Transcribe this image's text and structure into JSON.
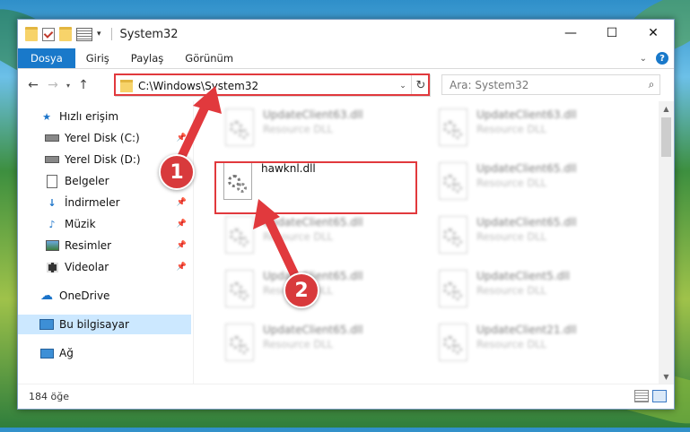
{
  "window": {
    "title": "System32"
  },
  "ribbon": {
    "tabs": [
      {
        "label": "Dosya"
      },
      {
        "label": "Giriş"
      },
      {
        "label": "Paylaş"
      },
      {
        "label": "Görünüm"
      }
    ]
  },
  "address": {
    "path": "C:\\Windows\\System32"
  },
  "search": {
    "placeholder": "Ara: System32"
  },
  "sidebar": {
    "items": [
      {
        "label": "Hızlı erişim",
        "icon": "star-icon"
      },
      {
        "label": "Yerel Disk (C:)",
        "icon": "drive-icon",
        "pinned": true
      },
      {
        "label": "Yerel Disk (D:)",
        "icon": "drive-icon",
        "pinned": false
      },
      {
        "label": "Belgeler",
        "icon": "document-icon",
        "pinned": true
      },
      {
        "label": "İndirmeler",
        "icon": "download-icon",
        "pinned": true
      },
      {
        "label": "Müzik",
        "icon": "music-icon",
        "pinned": true
      },
      {
        "label": "Resimler",
        "icon": "picture-icon",
        "pinned": true
      },
      {
        "label": "Videolar",
        "icon": "video-icon",
        "pinned": true
      },
      {
        "label": "OneDrive",
        "icon": "cloud-icon"
      },
      {
        "label": "Bu bilgisayar",
        "icon": "computer-icon",
        "selected": true
      },
      {
        "label": "Ağ",
        "icon": "network-icon"
      }
    ]
  },
  "files": [
    {
      "name": "UpdateClient63.dll",
      "desc": "Resource DLL",
      "blurred": true
    },
    {
      "name": "UpdateClient63.dll",
      "desc": "Resource DLL",
      "blurred": true
    },
    {
      "name": "hawknl.dll",
      "desc": "",
      "blurred": false
    },
    {
      "name": "UpdateClient65.dll",
      "desc": "Resource DLL",
      "blurred": true
    },
    {
      "name": "UpdateClient65.dll",
      "desc": "Resource DLL",
      "blurred": true
    },
    {
      "name": "UpdateClient65.dll",
      "desc": "Resource DLL",
      "blurred": true
    },
    {
      "name": "UpdateClient65.dll",
      "desc": "Resource DLL",
      "blurred": true
    },
    {
      "name": "UpdateClient5.dll",
      "desc": "Resource DLL",
      "blurred": true
    },
    {
      "name": "UpdateClient65.dll",
      "desc": "Resource DLL",
      "blurred": true
    },
    {
      "name": "UpdateClient21.dll",
      "desc": "Resource DLL",
      "blurred": true
    }
  ],
  "status": {
    "count": "184 öğe"
  },
  "callouts": {
    "step1": "1",
    "step2": "2"
  },
  "colors": {
    "accent": "#1979ca",
    "highlight": "#e1393d",
    "selected": "#cce8ff"
  }
}
